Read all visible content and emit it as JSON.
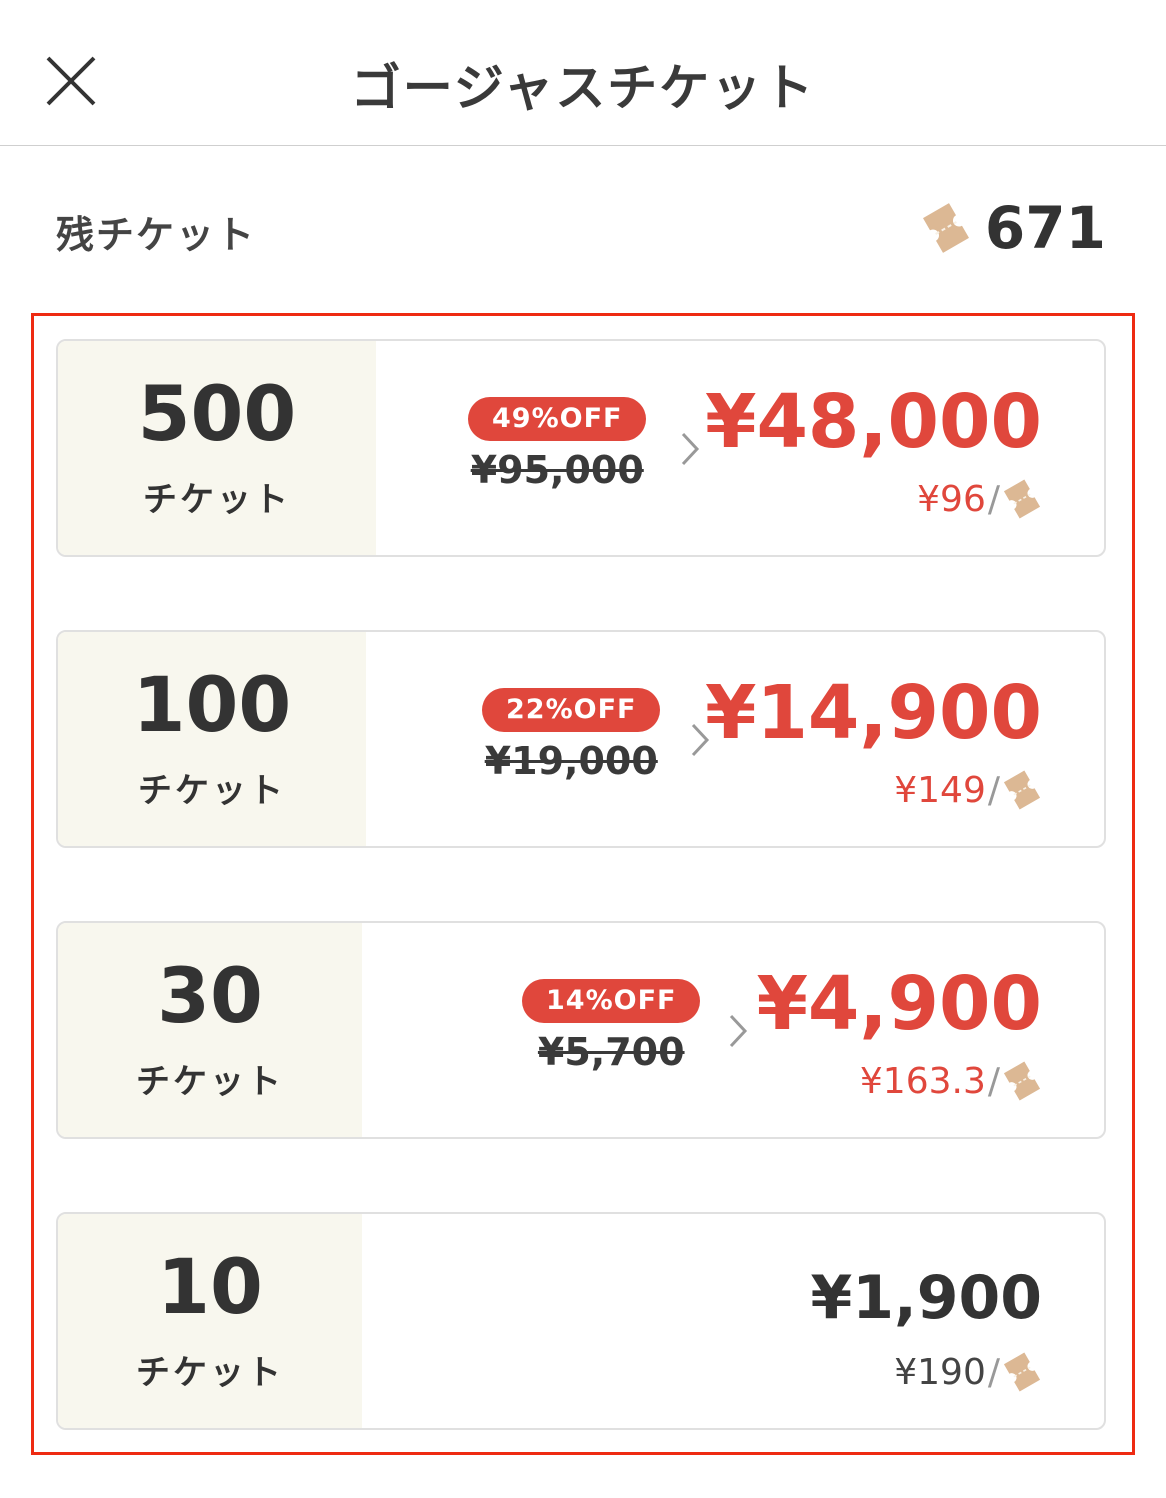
{
  "header": {
    "title": "ゴージャスチケット",
    "close_icon": "close-icon"
  },
  "remaining": {
    "label": "残チケット",
    "count": "671",
    "icon": "ticket-icon"
  },
  "colors": {
    "accent": "#e0473c",
    "highlight_border": "#ee2a12",
    "left_panel_bg": "#f8f7ee",
    "ticket_icon": "#dcb894"
  },
  "plans": [
    {
      "quantity": "500",
      "unit": "チケット",
      "discount": "49%OFF",
      "original_price": "¥95,000",
      "price": "¥48,000",
      "per_ticket": "¥96",
      "slash": "/"
    },
    {
      "quantity": "100",
      "unit": "チケット",
      "discount": "22%OFF",
      "original_price": "¥19,000",
      "price": "¥14,900",
      "per_ticket": "¥149",
      "slash": "/"
    },
    {
      "quantity": "30",
      "unit": "チケット",
      "discount": "14%OFF",
      "original_price": "¥5,700",
      "price": "¥4,900",
      "per_ticket": "¥163.3",
      "slash": "/"
    },
    {
      "quantity": "10",
      "unit": "チケット",
      "price": "¥1,900",
      "per_ticket": "¥190",
      "slash": "/"
    }
  ]
}
